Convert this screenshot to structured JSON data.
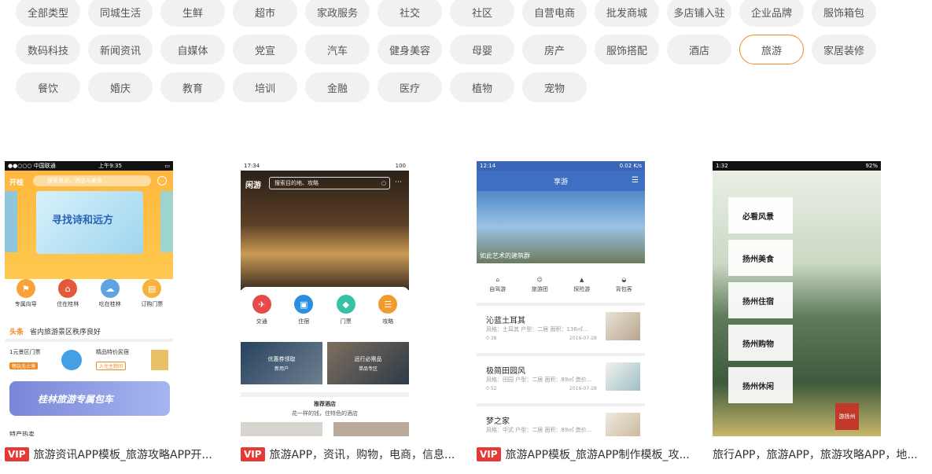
{
  "categories": {
    "rows": [
      [
        "全部类型",
        "同城生活",
        "生鲜",
        "超市",
        "家政服务",
        "社交",
        "社区",
        "自营电商",
        "批发商城",
        "多店铺入驻",
        "企业品牌",
        "服饰箱包"
      ],
      [
        "数码科技",
        "新闻资讯",
        "自媒体",
        "党宣",
        "汽车",
        "健身美容",
        "母婴",
        "房产",
        "服饰搭配",
        "酒店",
        "旅游",
        "家居装修"
      ],
      [
        "餐饮",
        "婚庆",
        "教育",
        "培训",
        "金融",
        "医疗",
        "植物",
        "宠物"
      ]
    ],
    "active": "旅游"
  },
  "cards": [
    {
      "vip": true,
      "caption": "旅游资讯APP模板_旅游攻略APP开...",
      "screen": {
        "status_left": "●●○○○ 中国联通",
        "status_time": "上午9:35",
        "app_name": "开桂",
        "search_placeholder": "搜索景点、酒店与美食",
        "banner_title": "寻找诗和远方",
        "icons": [
          "专属向导",
          "住在桂林",
          "吃在桂林",
          "订购门票"
        ],
        "headline_tag": "头条",
        "headline": "省内旅游景区秩序良好",
        "promo1_title": "1元景区门票",
        "promo1_sub": "畅玩无止境",
        "promo2_title": "精品特价民宿",
        "promo2_sub": "入住主题间",
        "bus_banner": "桂林旅游专属包车",
        "section": "特产热卖"
      }
    },
    {
      "vip": true,
      "caption": "旅游APP，资讯，购物，电商，信息...",
      "screen": {
        "status_time": "17:34",
        "status_right": "100",
        "logo": "闲游",
        "search_placeholder": "搜索目的地、攻略",
        "menu": [
          "交通",
          "住宿",
          "门票",
          "攻略"
        ],
        "coupon1": "优惠券领取",
        "coupon1_sub": "新用户",
        "coupon2": "远行必需品",
        "coupon2_sub": "单品专区",
        "section_title": "推荐酒店",
        "section_sub": "花一样的钱，住特色的酒店"
      }
    },
    {
      "vip": true,
      "caption": "旅游APP模板_旅游APP制作模板_攻...",
      "screen": {
        "status_time": "12:14",
        "status_right": "0.02 K/s",
        "title": "享游",
        "hero_caption": "如此艺术的建筑群",
        "nav": [
          "自驾游",
          "旅游团",
          "探险游",
          "背包客"
        ],
        "items": [
          {
            "title": "沁蓝土耳其",
            "meta": "风格：土耳其 户型：二居 面积：136㎡...",
            "date": "2016-07-28",
            "stats": "0  38"
          },
          {
            "title": "极简田园风",
            "meta": "风格：田园 户型：二居 面积：89㎡ 造价...",
            "date": "2016-07-28",
            "stats": "0  52"
          },
          {
            "title": "梦之家",
            "meta": "风格：中式 户型：二居 面积：89㎡ 造价...",
            "date": "",
            "stats": ""
          }
        ]
      }
    },
    {
      "vip": false,
      "caption": "旅行APP，旅游APP，旅游攻略APP，地...",
      "screen": {
        "status_time": "1:32",
        "status_right": "92%",
        "menu": [
          "必看风景",
          "扬州美食",
          "扬州住宿",
          "扬州购物",
          "扬州休闲"
        ],
        "seal": "游扬州"
      }
    }
  ],
  "vip_label": "VIP"
}
